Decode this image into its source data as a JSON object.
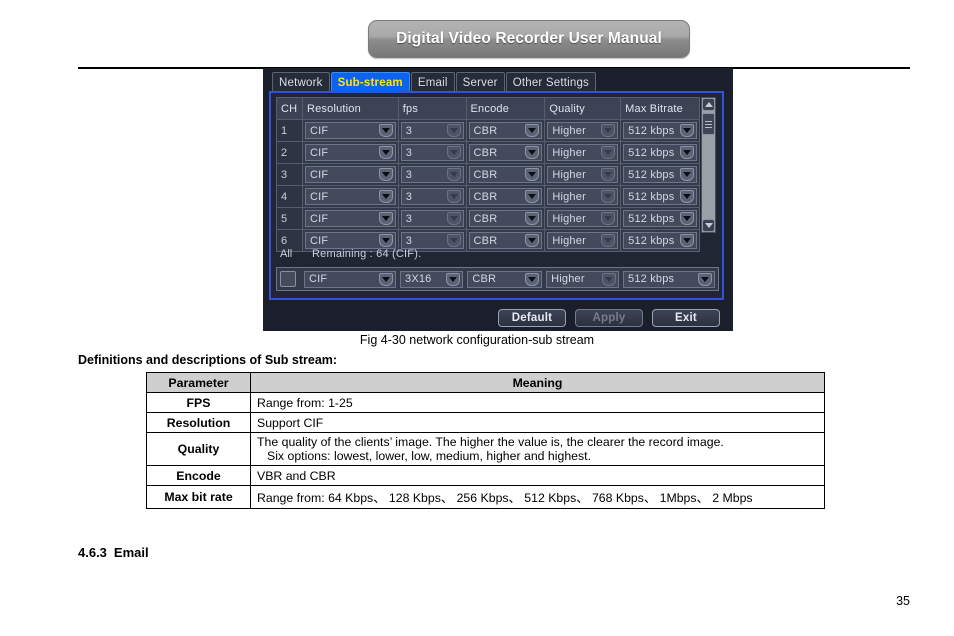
{
  "document": {
    "banner_title": "Digital Video Recorder User Manual",
    "figure_caption": "Fig 4-30 network configuration-sub stream",
    "definitions_title": "Definitions and descriptions of Sub stream:",
    "section_number": "4.6.3",
    "section_title": "Email",
    "page_number": "35"
  },
  "dvr": {
    "tabs": [
      {
        "label": "Network",
        "active": false
      },
      {
        "label": "Sub-stream",
        "active": true
      },
      {
        "label": "Email",
        "active": false
      },
      {
        "label": "Server",
        "active": false
      },
      {
        "label": "Other Settings",
        "active": false
      }
    ],
    "columns": [
      "CH",
      "Resolution",
      "fps",
      "Encode",
      "Quality",
      "Max Bitrate"
    ],
    "rows": [
      {
        "ch": "1",
        "resolution": "CIF",
        "fps": "3",
        "encode": "CBR",
        "quality": "Higher",
        "bitrate": "512 kbps"
      },
      {
        "ch": "2",
        "resolution": "CIF",
        "fps": "3",
        "encode": "CBR",
        "quality": "Higher",
        "bitrate": "512 kbps"
      },
      {
        "ch": "3",
        "resolution": "CIF",
        "fps": "3",
        "encode": "CBR",
        "quality": "Higher",
        "bitrate": "512 kbps"
      },
      {
        "ch": "4",
        "resolution": "CIF",
        "fps": "3",
        "encode": "CBR",
        "quality": "Higher",
        "bitrate": "512 kbps"
      },
      {
        "ch": "5",
        "resolution": "CIF",
        "fps": "3",
        "encode": "CBR",
        "quality": "Higher",
        "bitrate": "512 kbps"
      },
      {
        "ch": "6",
        "resolution": "CIF",
        "fps": "3",
        "encode": "CBR",
        "quality": "Higher",
        "bitrate": "512 kbps"
      }
    ],
    "all_row": {
      "label": "All",
      "remaining": "Remaining : 64 (CIF).",
      "resolution": "CIF",
      "fps": "3X16",
      "encode": "CBR",
      "quality": "Higher",
      "bitrate": "512 kbps",
      "checked": false
    },
    "buttons": {
      "default": "Default",
      "apply": "Apply",
      "exit": "Exit"
    },
    "colors": {
      "active_tab_bg": "#0b63ef",
      "active_tab_text": "#ffe600",
      "panel_border": "#3352d8",
      "panel_bg": "#202633"
    }
  },
  "definitions_table": {
    "headers": [
      "Parameter",
      "Meaning"
    ],
    "rows": [
      {
        "parameter": "FPS",
        "meaning": "Range from: 1-25",
        "meaning2": ""
      },
      {
        "parameter": "Resolution",
        "meaning": "Support CIF",
        "meaning2": ""
      },
      {
        "parameter": "Quality",
        "meaning": "The quality of the clients’ image. The higher the value is, the clearer the record image.",
        "meaning2": "Six options: lowest, lower, low, medium, higher and highest."
      },
      {
        "parameter": "Encode",
        "meaning": "VBR and CBR",
        "meaning2": ""
      },
      {
        "parameter": "Max bit rate",
        "meaning": "Range from: 64 Kbps、 128 Kbps、 256 Kbps、 512 Kbps、 768 Kbps、 1Mbps、 2 Mbps",
        "meaning2": ""
      }
    ]
  }
}
